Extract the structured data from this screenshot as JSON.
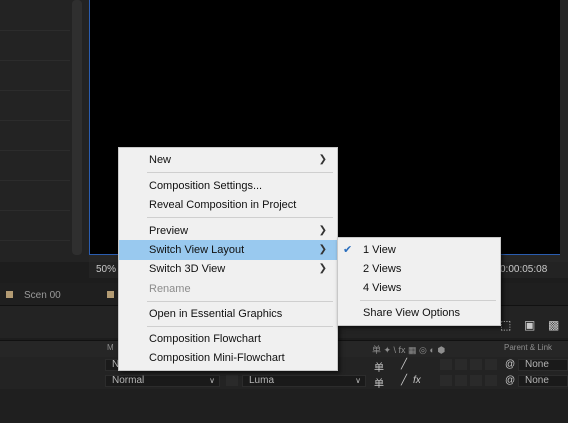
{
  "viewer": {
    "zoom": "50%",
    "time": "0:00:05:08"
  },
  "timeline": {
    "tab_label": "Scen 00",
    "header": {
      "mode_col": "M",
      "switches": "单 ✦ \\ fx ▦ ◎ ◐ ⬢",
      "parent_link": "Parent & Link"
    },
    "rows": [
      {
        "mode": "N",
        "parent": "None"
      },
      {
        "mode": "Normal",
        "trkmat": "Luma",
        "parent": "None"
      }
    ]
  },
  "context_menu": {
    "items": [
      {
        "label": "New",
        "submenu": true
      },
      {
        "label": "Composition Settings..."
      },
      {
        "label": "Reveal Composition in Project"
      },
      {
        "label": "Preview",
        "submenu": true
      },
      {
        "label": "Switch View Layout",
        "submenu": true,
        "highlighted": true
      },
      {
        "label": "Switch 3D View",
        "submenu": true
      },
      {
        "label": "Rename",
        "disabled": true
      },
      {
        "label": "Open in Essential Graphics"
      },
      {
        "label": "Composition Flowchart"
      },
      {
        "label": "Composition Mini-Flowchart"
      }
    ]
  },
  "view_layout_submenu": {
    "items": [
      {
        "label": "1 View",
        "checked": true
      },
      {
        "label": "2 Views"
      },
      {
        "label": "4 Views"
      },
      {
        "label": "Share View Options"
      }
    ]
  },
  "colors": {
    "highlight": "#99c9ef",
    "comp_border": "#2a5db0",
    "label_tan": "#b39b73"
  }
}
